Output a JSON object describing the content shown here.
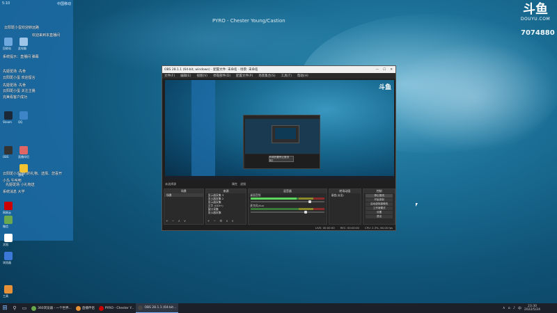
{
  "stream": {
    "title": "PYRO - Chester Young/Castion",
    "logo_mark": "斗鱼",
    "logo_url": "DOUYU.COM",
    "room_id": "7074880"
  },
  "side_panel": {
    "top_left": "5:10",
    "top_right": "中国移动",
    "chat": [
      "云阳斑小蛋欢迎转远路",
      "欢迎来到本直播间",
      "系统提示：直播间 弹幕",
      "先姬斑场 ·先骨",
      "云阳斑小蛋 欢迎留言",
      "先姬斑场 ·先骨",
      "云阳斑小蛋 关注主播",
      "完美看客户成功",
      "云阳斑小鸟随时的礼物、选择、您喜开",
      "小鸟 牛叫吧",
      "先姬斑场 小礼物送",
      "系统消息 大学"
    ],
    "desktop_icons": [
      {
        "label": "回收站",
        "color": "#6fa8dc"
      },
      {
        "label": "此电脑",
        "color": "#9fc5e8"
      },
      {
        "label": "Steam",
        "color": "#1b2838"
      },
      {
        "label": "QQ",
        "color": "#3d85c6"
      },
      {
        "label": "OBS",
        "color": "#333333"
      },
      {
        "label": "直播伴侣",
        "color": "#e06666"
      },
      {
        "label": "网易云",
        "color": "#cc0000"
      },
      {
        "label": "微信",
        "color": "#6aa84f"
      },
      {
        "label": "游戏",
        "color": "#f1c232"
      },
      {
        "label": "文档",
        "color": "#ffffff"
      },
      {
        "label": "浏览器",
        "color": "#3c78d8"
      },
      {
        "label": "工具",
        "color": "#e69138"
      }
    ]
  },
  "obs": {
    "title": "OBS 28.1.1 (64-bit, windows) - 配置文件: 未命名 - 场景: 未命名",
    "menu": [
      "文件(F)",
      "编辑(E)",
      "视图(V)",
      "停靠部件(D)",
      "配置文件(P)",
      "场景集合(S)",
      "工具(T)",
      "帮助(H)"
    ],
    "toolbar_left": "未选择源",
    "toolbar_buttons": [
      "属性",
      "滤镜"
    ],
    "scenes_header": "场景",
    "scenes": [
      "场景"
    ],
    "sources_header": "来源",
    "sources": [
      "显示器采集 3",
      "显示器采集 2",
      "显示器采集",
      "文字 (GDI+)",
      "窗口采集",
      "显示器采集"
    ],
    "mixer_header": "混音器",
    "mixer": [
      {
        "name": "桌面音频",
        "level": 0.62,
        "volume": 0.8
      },
      {
        "name": "麦克风/Aux",
        "level": 0.0,
        "volume": 0.75
      }
    ],
    "transitions_header": "转场动画",
    "transition_value": "渐变(淡出)",
    "controls_header": "控制",
    "controls": [
      "停止推流",
      "开始录制",
      "启动虚拟摄像机",
      "工作室模式",
      "设置",
      "退出"
    ],
    "status": [
      "LIVE: 00:00:00",
      "REC: 00:00:00",
      "CPU: 2.3%, 60.00 fps"
    ],
    "preview_dialog": "你真的要停止推流吗？"
  },
  "taskbar": {
    "tasks": [
      {
        "label": "360浏览器 - 一个世界...",
        "color": "#6aa84f",
        "active": false
      },
      {
        "label": "直播伴侣",
        "color": "#e69138",
        "active": false
      },
      {
        "label": "PYRO - Chester Y...",
        "color": "#cc0000",
        "active": false
      },
      {
        "label": "OBS 28.1.1 (64-bit...",
        "color": "#444444",
        "active": true
      }
    ],
    "tray_lang": "中",
    "time": "23:30",
    "date": "2022/5/24"
  }
}
